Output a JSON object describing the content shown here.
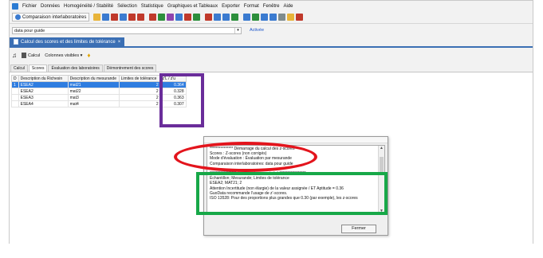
{
  "menubar": {
    "items": [
      "Fichier",
      "Données",
      "Homogénéité / Stabilité",
      "Sélection",
      "Statistique",
      "Graphiques et Tableaux",
      "Exporter",
      "Format",
      "Fenêtre",
      "Aide"
    ]
  },
  "toolbar": {
    "title": "Comparaison interlaboratoires",
    "button_colors": [
      "#e8b43a",
      "#3b7bd0",
      "#c0392b",
      "#3b7bd0",
      "#c0392b",
      "#c0392b",
      "#c0392b",
      "#2d8f3c",
      "#8e44ad",
      "#3b7bd0",
      "#c0392b",
      "#2d8f3c",
      "#c0392b",
      "#3b7bd0",
      "#3b7bd0",
      "#2d8f3c",
      "#3b7bd0",
      "#2d8f3c",
      "#3b7bd0",
      "#3b7bd0",
      "#7f8c8d",
      "#e8b43a",
      "#c0392b"
    ]
  },
  "selector": {
    "value": "data pour guide",
    "activate_label": "Activée"
  },
  "document_tab": {
    "title": "Calcul des scores et des limites de tolérance",
    "close": "×"
  },
  "subtoolbar": {
    "calcul_label": "Calcul",
    "columns_label": "Colonnes visibles ▾"
  },
  "tabs": [
    "Calcul",
    "Scores",
    "Évaluation des laboratoires",
    "Démontrement des scores"
  ],
  "table": {
    "headers": [
      "D",
      "Description du Richesin",
      "Description du mesurande",
      "Limites de tolérance",
      "z'L / z'u"
    ],
    "rows": [
      [
        "1",
        "ESEA2",
        "mat21",
        "2",
        "0.364"
      ],
      [
        "",
        "ESEA2",
        "mat22",
        "2",
        "0.328"
      ],
      [
        "",
        "ESEA3",
        "mat3",
        "2",
        "0.363"
      ],
      [
        "",
        "ESEA4",
        "mat4",
        "2",
        "0.307"
      ]
    ]
  },
  "dialog": {
    "log_lines": [
      "*************** Démarrage du calcul des z-scores",
      "Scores : Z-scores (non corrigés)",
      "Mode d'évaluation : Évaluation par mesurande",
      "Comparaison interlaboratoires: data pour guide",
      "",
      "***************** Z-scores (non corrigés) *****************",
      "Échantillon; Mesurande; Limites de tolérance",
      "ESEA2; MAT21; 2",
      "  Attention Incertitude (non élargie) de la valeur assignée / ET Aptitude = 0.36",
      "  GuoData recommande l'usage de z'-scores.",
      "  ISO 13528: Pour des proportions plus grandes que 0.30 (par exemple), les z-scores"
    ],
    "close_label": "Fermer"
  },
  "annotations": {
    "purple": "#6a2d9a",
    "red": "#e3141c",
    "green": "#17a848"
  }
}
